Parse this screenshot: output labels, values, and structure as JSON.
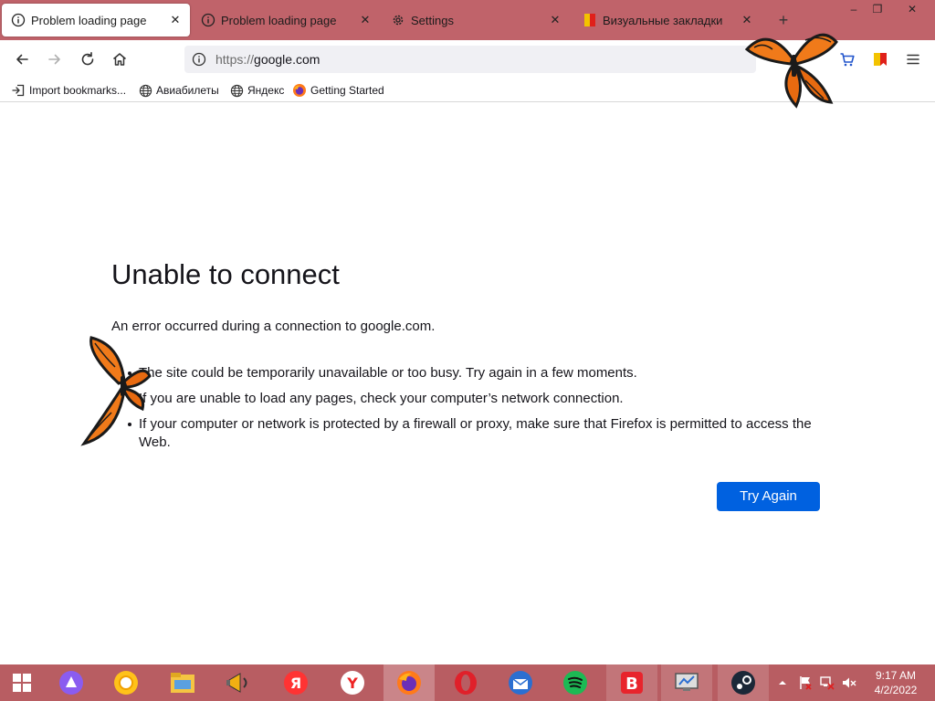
{
  "tabs": [
    {
      "label": "Problem loading page",
      "icon": "info-icon",
      "active": true
    },
    {
      "label": "Problem loading page",
      "icon": "info-icon",
      "active": false
    },
    {
      "label": "Settings",
      "icon": "gear-icon",
      "active": false
    },
    {
      "label": "Визуальные закладки",
      "icon": "visual-bookmarks-icon",
      "active": false
    }
  ],
  "tab_close_glyph": "✕",
  "new_tab_glyph": "+",
  "window_controls": {
    "minimize": "–",
    "restore": "❐",
    "close": "✕"
  },
  "navbar": {
    "url_scheme": "https://",
    "url_host": "google.com"
  },
  "bookmarks": [
    {
      "label": "Import bookmarks...",
      "icon": "import-icon"
    },
    {
      "label": "Авиабилеты",
      "icon": "globe-icon"
    },
    {
      "label": "Яндекс",
      "icon": "globe-icon"
    },
    {
      "label": "Getting Started",
      "icon": "firefox-icon"
    }
  ],
  "error": {
    "title": "Unable to connect",
    "description": "An error occurred during a connection to google.com.",
    "items": [
      "The site could be temporarily unavailable or too busy. Try again in a few moments.",
      "If you are unable to load any pages, check your computer’s network connection.",
      "If your computer or network is protected by a firewall or proxy, make sure that Firefox is permitted to access the Web."
    ],
    "button_label": "Try Again"
  },
  "taskbar": {
    "apps": [
      "windows-start-icon",
      "alice-icon",
      "yandex-browser-icon",
      "file-explorer-icon",
      "megaphone-icon",
      "yandex-icon",
      "yandex-y-icon",
      "firefox-icon",
      "opera-icon",
      "thunderbird-icon",
      "spotify-icon",
      "vivaldi-b-icon",
      "remote-desktop-icon",
      "steam-icon"
    ],
    "clock_time": "9:17 AM",
    "clock_date": "4/2/2022"
  },
  "colors": {
    "tabbar": "#c0636a",
    "taskbar": "#b85d62",
    "accent": "#0061e0"
  }
}
